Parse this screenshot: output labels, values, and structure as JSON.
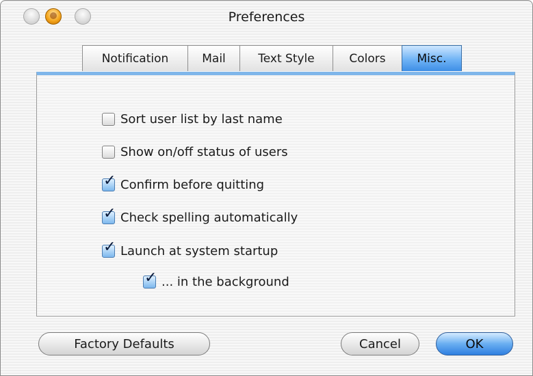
{
  "window": {
    "title": "Preferences"
  },
  "tabs": [
    {
      "label": "Notification",
      "selected": false
    },
    {
      "label": "Mail",
      "selected": false
    },
    {
      "label": "Text Style",
      "selected": false
    },
    {
      "label": "Colors",
      "selected": false
    },
    {
      "label": "Misc.",
      "selected": true
    }
  ],
  "options": [
    {
      "label": "Sort user list by last name",
      "checked": false
    },
    {
      "label": "Show on/off status of users",
      "checked": false
    },
    {
      "label": "Confirm before quitting",
      "checked": true
    },
    {
      "label": "Check spelling automatically",
      "checked": true
    },
    {
      "label": "Launch at system startup",
      "checked": true
    },
    {
      "label": "... in the background",
      "checked": true
    }
  ],
  "buttons": {
    "factory_defaults": "Factory Defaults",
    "cancel": "Cancel",
    "ok": "OK"
  },
  "colors": {
    "accent": "#4a90e2",
    "window_close": "#dedede",
    "window_minimize": "#f4a51c",
    "window_zoom": "#dedede"
  }
}
